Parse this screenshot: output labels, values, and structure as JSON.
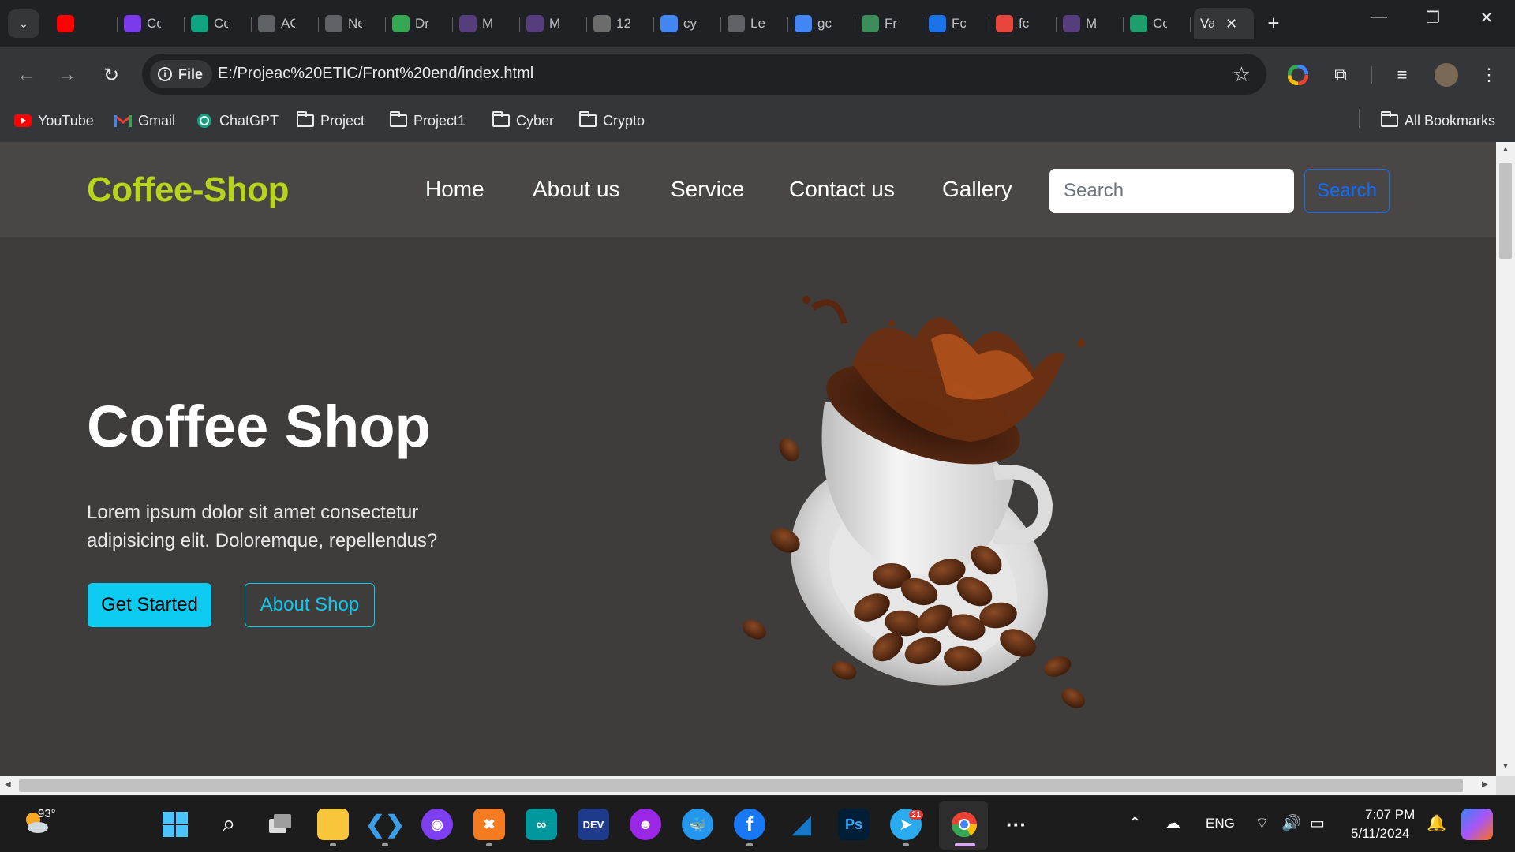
{
  "browser": {
    "tabs": [
      {
        "label": "",
        "icon": "youtube-audio-icon",
        "color": "#ff0000"
      },
      {
        "label": "Cc",
        "icon": "bootstrap-icon",
        "color": "#7c3aed"
      },
      {
        "label": "Cc",
        "icon": "chatgpt-icon",
        "color": "#10a37f"
      },
      {
        "label": "AC",
        "icon": "globe-icon",
        "color": "#5f6368"
      },
      {
        "label": "Ne",
        "icon": "chrome-like-icon",
        "color": "#5f6368"
      },
      {
        "label": "Dr",
        "icon": "leaf-icon",
        "color": "#34a853"
      },
      {
        "label": "M",
        "icon": "bootstrap-icon",
        "color": "#563d7c"
      },
      {
        "label": "M",
        "icon": "bootstrap-icon",
        "color": "#563d7c"
      },
      {
        "label": "12",
        "icon": "bootstrap-icon",
        "color": "#6c6c6c"
      },
      {
        "label": "cy",
        "icon": "google-icon",
        "color": "#4285f4"
      },
      {
        "label": "Le",
        "icon": "globe-icon",
        "color": "#5f6368"
      },
      {
        "label": "gc",
        "icon": "google-icon",
        "color": "#4285f4"
      },
      {
        "label": "Fr",
        "icon": "robot-icon",
        "color": "#3c8d5a"
      },
      {
        "label": "Fc",
        "icon": "flag-icon",
        "color": "#1a73e8"
      },
      {
        "label": "fc",
        "icon": "code-icon",
        "color": "#e8453c"
      },
      {
        "label": "M",
        "icon": "bootstrap-icon",
        "color": "#563d7c"
      },
      {
        "label": "Cc",
        "icon": "chatgpt-icon",
        "color": "#1e9e6a"
      }
    ],
    "active_tab": {
      "label": "Va",
      "close": "✕"
    },
    "new_tab": "+",
    "window_controls": {
      "minimize": "—",
      "restore": "❐",
      "close": "✕"
    },
    "address": {
      "scheme_chip": "File",
      "url": "E:/Projeac%20ETIC/Front%20end/index.html"
    },
    "bookmarks": [
      {
        "label": "YouTube",
        "icon": "youtube-icon"
      },
      {
        "label": "Gmail",
        "icon": "gmail-icon"
      },
      {
        "label": "ChatGPT",
        "icon": "chatgpt-icon"
      },
      {
        "label": "Project",
        "icon": "folder-icon"
      },
      {
        "label": "Project1",
        "icon": "folder-icon"
      },
      {
        "label": "Cyber",
        "icon": "folder-icon"
      },
      {
        "label": "Crypto",
        "icon": "folder-icon"
      }
    ],
    "all_bookmarks": "All Bookmarks"
  },
  "site": {
    "brand": "Coffee-Shop",
    "nav": [
      "Home",
      "About us",
      "Service",
      "Contact us",
      "Gallery"
    ],
    "search_placeholder": "Search",
    "search_button": "Search",
    "hero": {
      "title": "Coffee Shop",
      "text": "Lorem ipsum dolor sit amet consectetur adipisicing elit. Doloremque, repellendus?",
      "primary_button": "Get Started",
      "secondary_button": "About Shop"
    },
    "colors": {
      "brand": "#b8d41c",
      "accent": "#0dcaf0",
      "search": "#0d6efd",
      "bg": "#3f3c3c",
      "nav_bg": "#4a4646"
    }
  },
  "taskbar": {
    "weather_temp": "93°",
    "apps": [
      "windows-start-icon",
      "search-icon",
      "task-view-icon",
      "file-explorer-icon",
      "vscode-icon",
      "tor-icon",
      "xampp-icon",
      "arduino-icon",
      "devcpp-icon",
      "mask-icon",
      "docker-icon",
      "facebook-icon",
      "wireshark-icon",
      "photoshop-icon",
      "telegram-icon",
      "chrome-icon",
      "more-icon"
    ],
    "telegram_badge": "21",
    "language": "ENG",
    "time": "7:07 PM",
    "date": "5/11/2024"
  }
}
